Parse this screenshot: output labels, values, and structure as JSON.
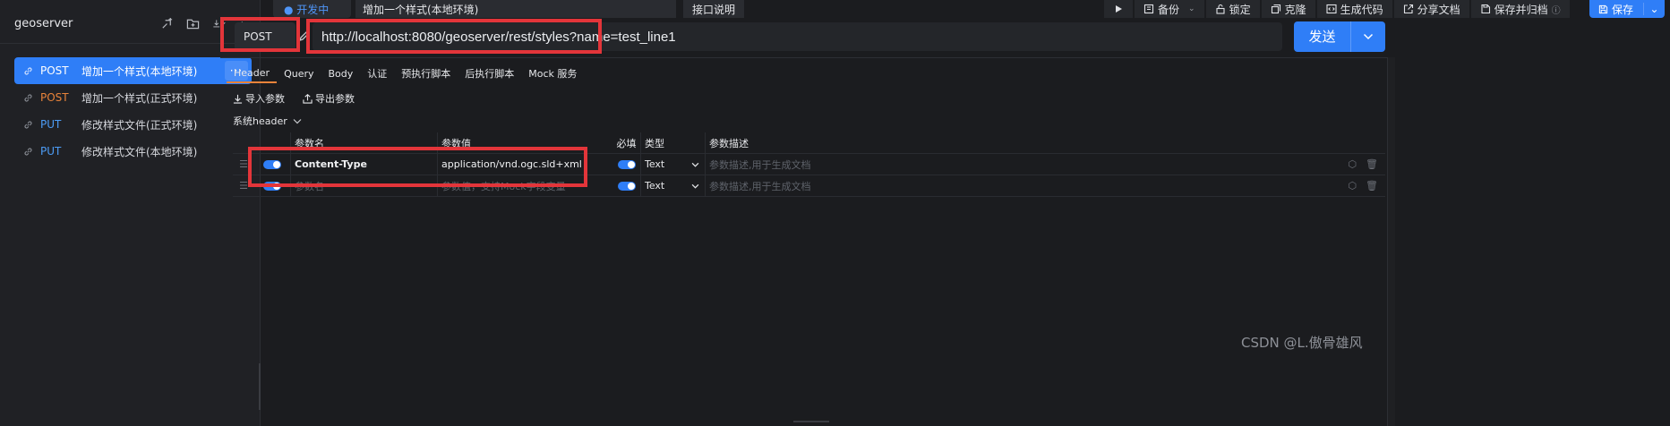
{
  "sidebar": {
    "project_title": "geoserver",
    "items": [
      {
        "method": "POST",
        "name": "增加一个样式(本地环境)",
        "active": true
      },
      {
        "method": "POST",
        "name": "增加一个样式(正式环境)",
        "active": false
      },
      {
        "method": "PUT",
        "name": "修改样式文件(正式环境)",
        "active": false
      },
      {
        "method": "PUT",
        "name": "修改样式文件(本地环境)",
        "active": false
      }
    ],
    "more_label": "···"
  },
  "topbar": {
    "env_label": "● 开发中",
    "tab_name": "增加一个样式(本地环境)",
    "doc_label": "接口说明",
    "actions": [
      {
        "icon": "play-icon",
        "label": ""
      },
      {
        "icon": "backup-icon",
        "label": "备份"
      },
      {
        "icon": "lock-icon",
        "label": "锁定"
      },
      {
        "icon": "clone-icon",
        "label": "克隆"
      },
      {
        "icon": "code-icon",
        "label": "生成代码"
      },
      {
        "icon": "share-icon",
        "label": "分享文档"
      },
      {
        "icon": "save-archive-icon",
        "label": "保存并归档"
      }
    ],
    "save_label": "保存"
  },
  "request": {
    "method": "POST",
    "url": "http://localhost:8080/geoserver/rest/styles?name=test_line1",
    "send_label": "发送"
  },
  "tabs": [
    "Header",
    "Query",
    "Body",
    "认证",
    "预执行脚本",
    "后执行脚本",
    "Mock 服务"
  ],
  "params": {
    "import_label": "导入参数",
    "export_label": "导出参数",
    "system_header_label": "系统header"
  },
  "table": {
    "headers": {
      "name": "参数名",
      "value": "参数值",
      "required": "必填",
      "type": "类型",
      "desc": "参数描述"
    },
    "rows": [
      {
        "name": "Content-Type",
        "value": "application/vnd.ogc.sld+xml",
        "type": "Text",
        "desc_placeholder": "参数描述,用于生成文档"
      },
      {
        "name_placeholder": "参数名",
        "value_placeholder": "参数值，支持Mock字段变量",
        "type": "Text",
        "desc_placeholder": "参数描述,用于生成文档"
      }
    ]
  },
  "watermark": "CSDN @L.傲骨雄风",
  "colors": {
    "accent": "#2f7ef7",
    "post": "#e8833a",
    "put": "#4c9cf6",
    "annotation": "#e3353a"
  }
}
